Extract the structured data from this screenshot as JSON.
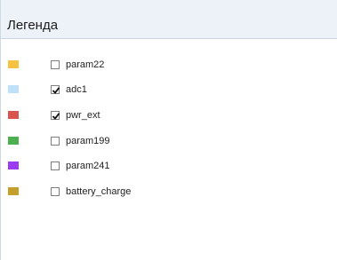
{
  "legend": {
    "title": "Легенда",
    "items": [
      {
        "label": "param22",
        "color": "#f5c242",
        "checked": false
      },
      {
        "label": "adc1",
        "color": "#bfe0f9",
        "checked": true
      },
      {
        "label": "pwr_ext",
        "color": "#d9534f",
        "checked": true
      },
      {
        "label": "param199",
        "color": "#4caf50",
        "checked": false
      },
      {
        "label": "param241",
        "color": "#9b3cf2",
        "checked": false
      },
      {
        "label": "battery_charge",
        "color": "#c4a02a",
        "checked": false
      }
    ]
  }
}
